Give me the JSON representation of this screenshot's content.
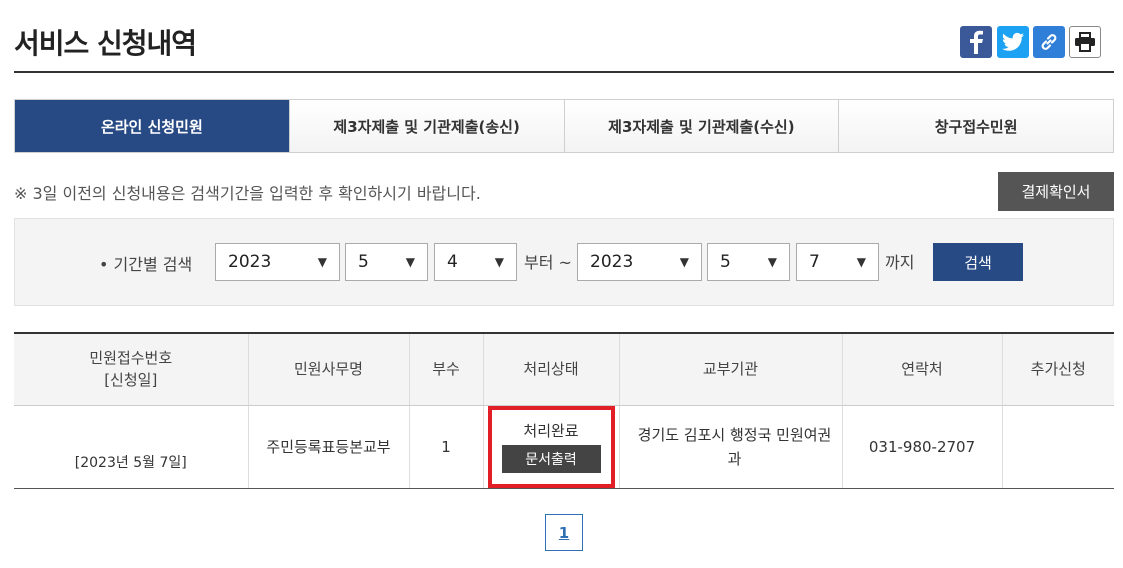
{
  "page": {
    "title": "서비스 신청내역"
  },
  "share": {
    "icons": [
      "facebook-icon",
      "twitter-icon",
      "link-icon",
      "print-icon"
    ]
  },
  "tabs": [
    {
      "label": "온라인 신청민원",
      "active": true
    },
    {
      "label": "제3자제출 및 기관제출(송신)",
      "active": false
    },
    {
      "label": "제3자제출 및 기관제출(수신)",
      "active": false
    },
    {
      "label": "창구접수민원",
      "active": false
    }
  ],
  "notice": "※ 3일 이전의 신청내용은 검색기간을 입력한 후 확인하시기 바랍니다.",
  "payment_button": "결제확인서",
  "search": {
    "label": "• 기간별 검색",
    "from": {
      "year": "2023",
      "month": "5",
      "day": "4"
    },
    "from_suffix": "부터 ~",
    "to": {
      "year": "2023",
      "month": "5",
      "day": "7"
    },
    "to_suffix": "까지",
    "button": "검색"
  },
  "table": {
    "headers": [
      "민원접수번호\n[신청일]",
      "민원사무명",
      "부수",
      "처리상태",
      "교부기관",
      "연락처",
      "추가신청"
    ],
    "header_line1": "민원접수번호",
    "header_line2": "[신청일]",
    "rows": [
      {
        "date": "[2023년 5월 7일]",
        "service": "주민등록표등본교부",
        "copies": "1",
        "status": "처리완료",
        "print_button": "문서출력",
        "org": "경기도 김포시 행정국 민원여권과",
        "contact": "031-980-2707",
        "extra": ""
      }
    ]
  },
  "pagination": {
    "current": "1"
  },
  "colors": {
    "primary": "#274a84",
    "highlight": "#e21e26",
    "dark_button": "#444444"
  }
}
